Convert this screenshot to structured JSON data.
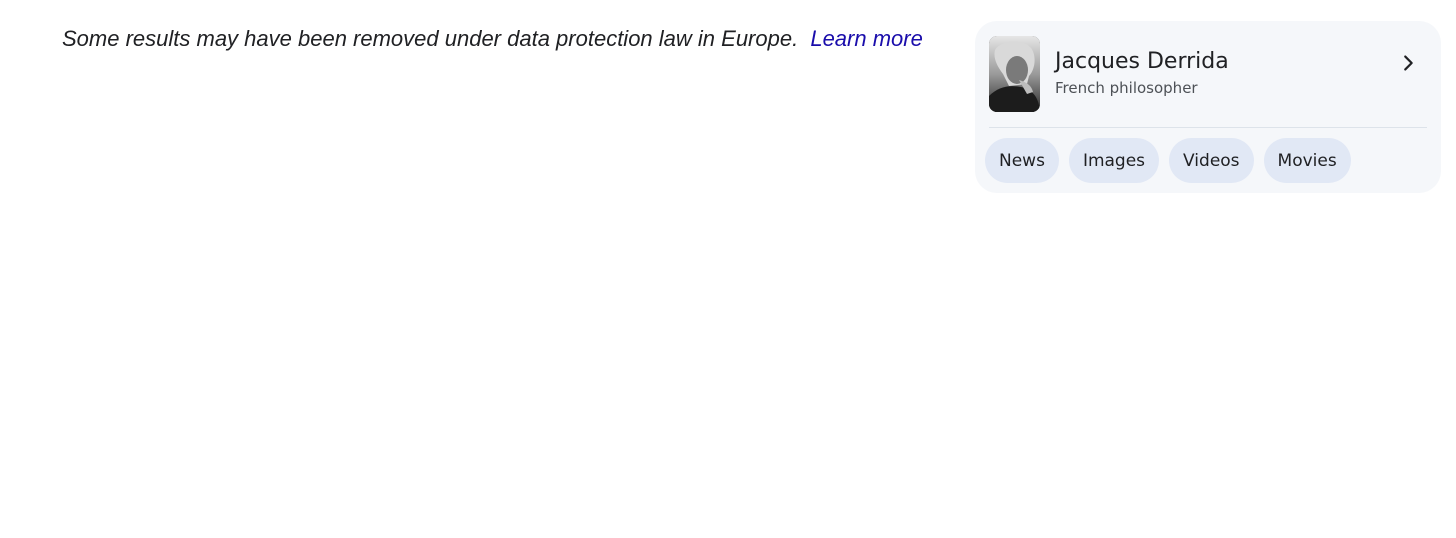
{
  "notice": {
    "text": "Some results may have been removed under data protection law in Europe.",
    "link_label": "Learn more"
  },
  "knowledge_panel": {
    "title": "Jacques Derrida",
    "subtitle": "French philosopher",
    "thumbnail_icon": "person-photo",
    "chevron_icon": "chevron-right-icon",
    "chips": [
      {
        "label": "News"
      },
      {
        "label": "Images"
      },
      {
        "label": "Videos"
      },
      {
        "label": "Movies"
      }
    ]
  },
  "colors": {
    "link": "#1a0dab",
    "card_background": "#f5f7fa",
    "chip_background": "#e1e8f5"
  }
}
